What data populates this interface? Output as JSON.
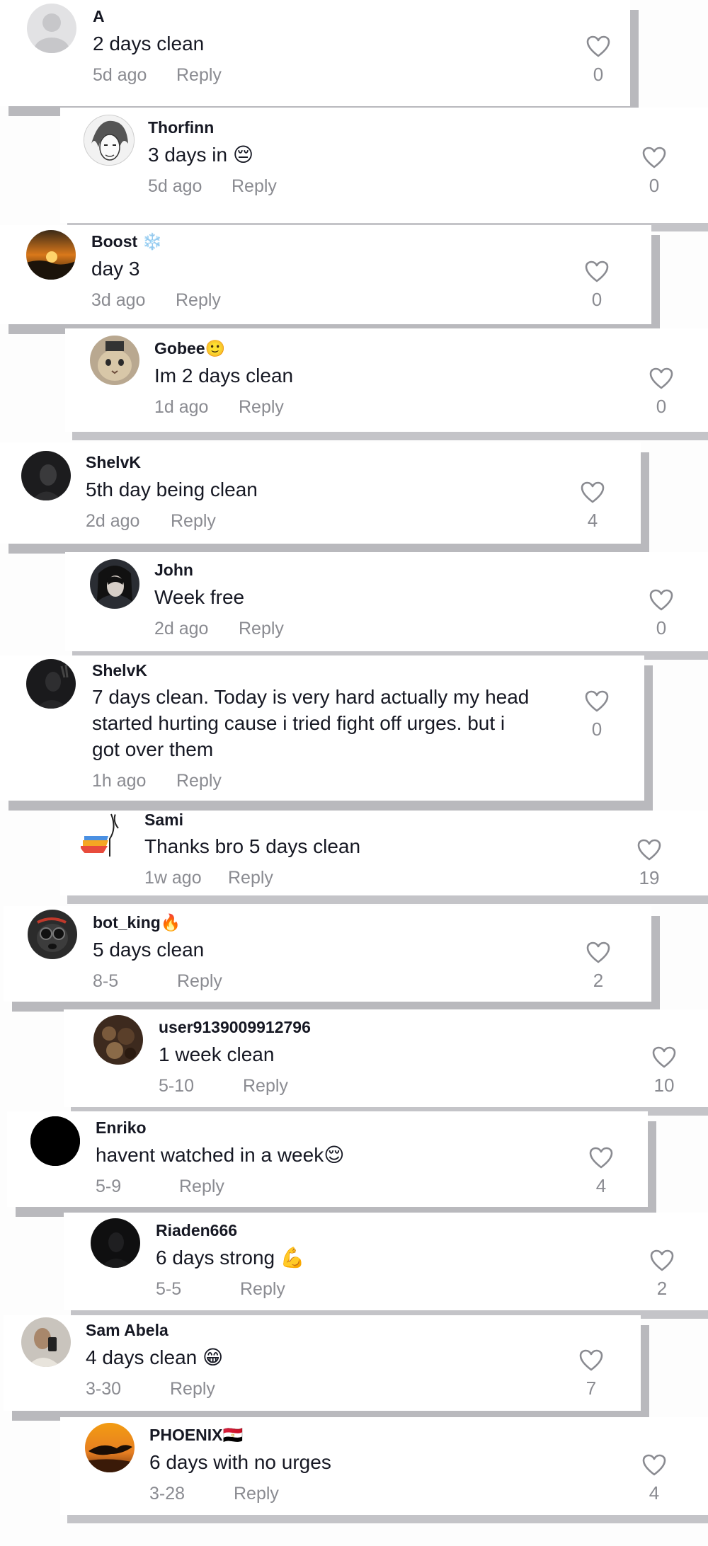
{
  "comments": [
    {
      "user": "A",
      "text": "2 days clean",
      "time": "5d ago",
      "reply": "Reply",
      "likes": "0"
    },
    {
      "user": "Thorfinn",
      "text": "3 days in 😔",
      "time": "5d ago",
      "reply": "Reply",
      "likes": "0"
    },
    {
      "user": "Boost ❄️",
      "text": "day 3",
      "time": "3d ago",
      "reply": "Reply",
      "likes": "0"
    },
    {
      "user": "Gobee🙂",
      "text": "Im 2 days clean",
      "time": "1d ago",
      "reply": "Reply",
      "likes": "0"
    },
    {
      "user": "ShelvK",
      "text": "5th day being clean",
      "time": "2d ago",
      "reply": "Reply",
      "likes": "4"
    },
    {
      "user": "John",
      "text": "Week free",
      "time": "2d ago",
      "reply": "Reply",
      "likes": "0"
    },
    {
      "user": "ShelvK",
      "text": "7 days clean. Today is very hard actually my head\nstarted hurting cause i tried fight off urges. but i\ngot over them",
      "time": "1h ago",
      "reply": "Reply",
      "likes": "0"
    },
    {
      "user": "Sami",
      "text": "Thanks bro 5 days clean",
      "time": "1w ago",
      "reply": "Reply",
      "likes": "19"
    },
    {
      "user": "bot_king🔥",
      "text": "5 days clean",
      "time": "8-5",
      "reply": "Reply",
      "likes": "2"
    },
    {
      "user": "user9139009912796",
      "text": "1 week clean",
      "time": "5-10",
      "reply": "Reply",
      "likes": "10"
    },
    {
      "user": "Enriko",
      "text": "havent watched in a week😌",
      "time": "5-9",
      "reply": "Reply",
      "likes": "4"
    },
    {
      "user": "Riaden666",
      "text": "6 days strong 💪",
      "time": "5-5",
      "reply": "Reply",
      "likes": "2"
    },
    {
      "user": "Sam Abela",
      "text": "4 days clean 😁",
      "time": "3-30",
      "reply": "Reply",
      "likes": "7"
    },
    {
      "user": "PHOENIX🇪🇬",
      "text": "6 days with no urges",
      "time": "3-28",
      "reply": "Reply",
      "likes": "4"
    }
  ],
  "icons": {
    "like": "heart-outline-icon"
  },
  "colors": {
    "text": "#161823",
    "muted": "#8a8b91",
    "shadow": "#b9b9bd"
  }
}
